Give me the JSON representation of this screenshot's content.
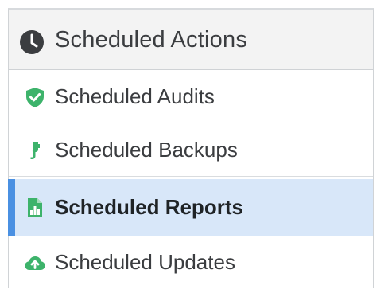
{
  "panel": {
    "title": "Scheduled Actions",
    "title_icon": "clock-icon"
  },
  "menu": {
    "items": [
      {
        "label": "Scheduled Audits",
        "icon": "shield-check-icon",
        "icon_color": "#3db36b",
        "active": false
      },
      {
        "label": "Scheduled Backups",
        "icon": "power-plug-icon",
        "icon_color": "#3db36b",
        "active": false
      },
      {
        "label": "Scheduled Reports",
        "icon": "report-chart-icon",
        "icon_color": "#3db36b",
        "active": true
      },
      {
        "label": "Scheduled Updates",
        "icon": "cloud-upload-icon",
        "icon_color": "#3db36b",
        "active": false
      }
    ]
  },
  "colors": {
    "accent": "#4a90e2",
    "active_background": "#d8e7f9",
    "icon_green": "#3db36b",
    "text": "#3b3d40"
  }
}
